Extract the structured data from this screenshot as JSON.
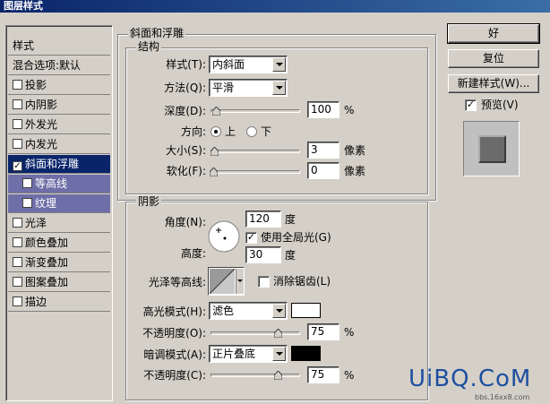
{
  "window": {
    "title": "图层样式"
  },
  "style_list": {
    "header": "样式",
    "blend_defaults": "混合选项:默认",
    "items": [
      {
        "label": "投影",
        "checked": false
      },
      {
        "label": "内阴影",
        "checked": false
      },
      {
        "label": "外发光",
        "checked": false
      },
      {
        "label": "内发光",
        "checked": false
      },
      {
        "label": "斜面和浮雕",
        "checked": true
      },
      {
        "label": "等高线",
        "checked": false
      },
      {
        "label": "纹理",
        "checked": false
      },
      {
        "label": "光泽",
        "checked": false
      },
      {
        "label": "颜色叠加",
        "checked": false
      },
      {
        "label": "渐变叠加",
        "checked": false
      },
      {
        "label": "图案叠加",
        "checked": false
      },
      {
        "label": "描边",
        "checked": false
      }
    ]
  },
  "bevel": {
    "section_title": "斜面和浮雕",
    "structure_title": "结构",
    "style_label": "样式(T):",
    "style_value": "内斜面",
    "technique_label": "方法(Q):",
    "technique_value": "平滑",
    "depth_label": "深度(D):",
    "depth_value": "100",
    "depth_unit": "%",
    "direction_label": "方向:",
    "direction_up": "上",
    "direction_down": "下",
    "size_label": "大小(S):",
    "size_value": "3",
    "size_unit": "像素",
    "soften_label": "软化(F):",
    "soften_value": "0",
    "soften_unit": "像素"
  },
  "shading": {
    "title": "阴影",
    "angle_label": "角度(N):",
    "angle_value": "120",
    "angle_unit": "度",
    "global_light_label": "使用全局光(G)",
    "global_light_checked": true,
    "altitude_label": "高度:",
    "altitude_value": "30",
    "altitude_unit": "度",
    "gloss_contour_label": "光泽等高线:",
    "antialias_label": "消除锯齿(L)",
    "antialias_checked": false,
    "highlight_mode_label": "高光模式(H):",
    "highlight_mode_value": "滤色",
    "highlight_color": "#ffffff",
    "highlight_opacity_label": "不透明度(O):",
    "highlight_opacity_value": "75",
    "highlight_opacity_unit": "%",
    "shadow_mode_label": "暗调模式(A):",
    "shadow_mode_value": "正片叠底",
    "shadow_color": "#000000",
    "shadow_opacity_label": "不透明度(C):",
    "shadow_opacity_value": "75",
    "shadow_opacity_unit": "%"
  },
  "actions": {
    "ok": "好",
    "reset": "复位",
    "new_style": "新建样式(W)...",
    "preview_label": "预览(V)",
    "preview_checked": true
  },
  "watermark": {
    "text": "UiBQ.CoM",
    "subtext": "bbs.16xx8.com"
  },
  "colors": {
    "selection": "#0a246a",
    "sub_item": "#6e6ea8",
    "dialog": "#d4d0c8"
  }
}
